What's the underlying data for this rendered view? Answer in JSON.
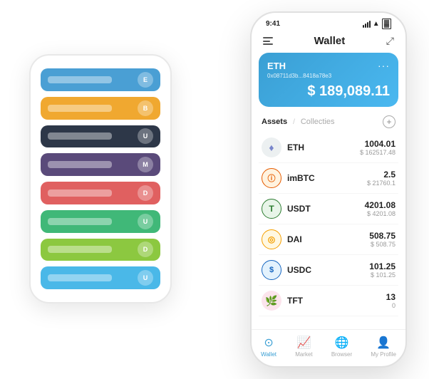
{
  "bg_phone": {
    "cards": [
      {
        "id": "card-blue",
        "color_class": "card-blue",
        "icon_text": "E"
      },
      {
        "id": "card-orange",
        "color_class": "card-orange",
        "icon_text": "B"
      },
      {
        "id": "card-dark",
        "color_class": "card-dark",
        "icon_text": "U"
      },
      {
        "id": "card-purple",
        "color_class": "card-purple",
        "icon_text": "M"
      },
      {
        "id": "card-red",
        "color_class": "card-red",
        "icon_text": "D"
      },
      {
        "id": "card-green",
        "color_class": "card-green",
        "icon_text": "U"
      },
      {
        "id": "card-lime",
        "color_class": "card-lime",
        "icon_text": "D"
      },
      {
        "id": "card-lightblue",
        "color_class": "card-lightblue",
        "icon_text": "U"
      }
    ]
  },
  "fg_phone": {
    "status_bar": {
      "time": "9:41",
      "wifi": true,
      "battery": true
    },
    "header": {
      "menu_label": "menu",
      "title": "Wallet",
      "expand_label": "expand"
    },
    "eth_card": {
      "label": "ETH",
      "address": "0x08711d3b...8418a78e3",
      "dots": "···",
      "balance": "$ 189,089.11"
    },
    "assets_section": {
      "tab_active": "Assets",
      "tab_separator": "/",
      "tab_inactive": "Collecties",
      "add_label": "+"
    },
    "assets": [
      {
        "name": "ETH",
        "icon_text": "♦",
        "icon_class": "icon-eth",
        "amount": "1004.01",
        "usd": "$ 162517.48"
      },
      {
        "name": "imBTC",
        "icon_text": "⊕",
        "icon_class": "icon-imbtc",
        "amount": "2.5",
        "usd": "$ 21760.1"
      },
      {
        "name": "USDT",
        "icon_text": "T",
        "icon_class": "icon-usdt",
        "amount": "4201.08",
        "usd": "$ 4201.08"
      },
      {
        "name": "DAI",
        "icon_text": "◎",
        "icon_class": "icon-dai",
        "amount": "508.75",
        "usd": "$ 508.75"
      },
      {
        "name": "USDC",
        "icon_text": "$",
        "icon_class": "icon-usdc",
        "amount": "101.25",
        "usd": "$ 101.25"
      },
      {
        "name": "TFT",
        "icon_text": "🌿",
        "icon_class": "icon-tft",
        "amount": "13",
        "usd": "0"
      }
    ],
    "bottom_nav": [
      {
        "id": "wallet",
        "label": "Wallet",
        "icon": "⊙",
        "active": true
      },
      {
        "id": "market",
        "label": "Market",
        "icon": "📊",
        "active": false
      },
      {
        "id": "browser",
        "label": "Browser",
        "icon": "🌐",
        "active": false
      },
      {
        "id": "profile",
        "label": "My Profile",
        "icon": "👤",
        "active": false
      }
    ]
  }
}
